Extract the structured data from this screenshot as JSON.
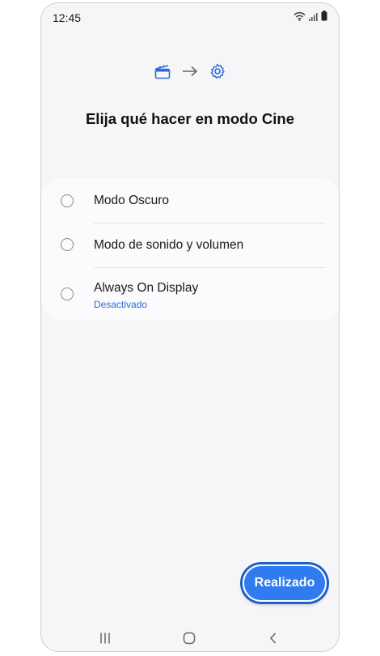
{
  "status_bar": {
    "time": "12:45",
    "icons": [
      "wifi-icon",
      "signal-icon",
      "battery-icon"
    ]
  },
  "header": {
    "icons": [
      "clapperboard-icon",
      "arrow-right-icon",
      "gear-icon"
    ],
    "title": "Elija qué hacer en modo Cine"
  },
  "options": [
    {
      "label": "Modo Oscuro",
      "selected": false
    },
    {
      "label": "Modo de sonido y volumen",
      "selected": false
    },
    {
      "label": "Always On Display",
      "sublabel": "Desactivado",
      "selected": false
    }
  ],
  "done_button": {
    "label": "Realizado"
  },
  "nav_bar": {
    "icons": [
      "recent-apps-icon",
      "home-icon",
      "back-icon"
    ]
  },
  "colors": {
    "accent": "#2f7cf0",
    "sublabel": "#2d6bd6",
    "background": "#f6f6f8",
    "card": "#fbfbfd"
  }
}
